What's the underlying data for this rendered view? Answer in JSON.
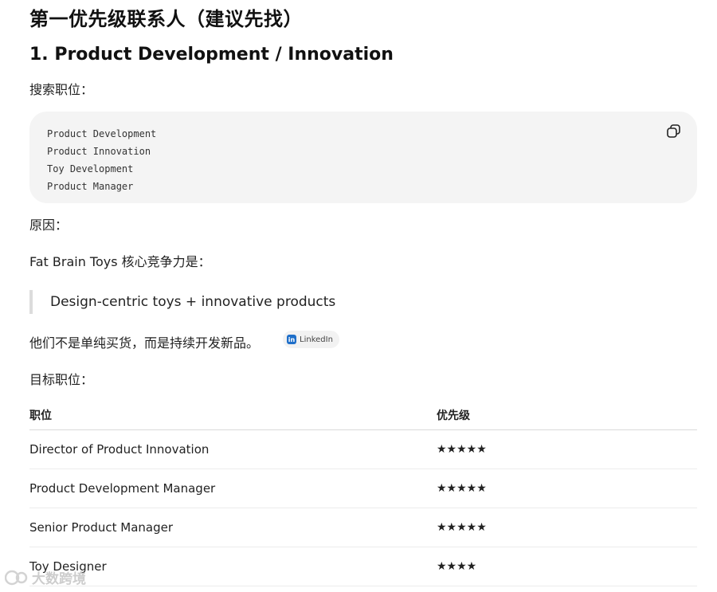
{
  "heading": "第一优先级联系人（建议先找）",
  "subheading": "1. Product Development / Innovation",
  "search_label": "搜索职位：",
  "code_lines": [
    "Product Development",
    "Product Innovation",
    "Toy Development",
    "Product Manager"
  ],
  "reason_label": "原因：",
  "core_text": "Fat Brain Toys 核心竞争力是：",
  "quote": "Design-centric toys + innovative products",
  "statement": "他们不是单纯买货，而是持续开发新品。",
  "source_chip": {
    "label": "LinkedIn",
    "icon": "linkedin-icon"
  },
  "target_label": "目标职位：",
  "table": {
    "headers": [
      "职位",
      "优先级"
    ],
    "rows": [
      {
        "title": "Director of Product Innovation",
        "priority": "★★★★★"
      },
      {
        "title": "Product Development Manager",
        "priority": "★★★★★"
      },
      {
        "title": "Senior Product Manager",
        "priority": "★★★★★"
      },
      {
        "title": "Toy Designer",
        "priority": "★★★★"
      }
    ]
  },
  "watermark": "大数跨境"
}
